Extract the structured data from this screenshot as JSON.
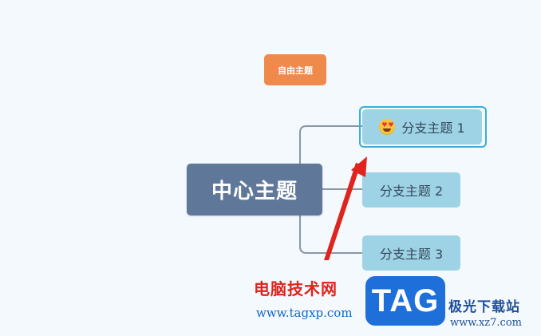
{
  "mindmap": {
    "floating_topic": "自由主题",
    "central_topic": "中心主题",
    "branches": [
      "分支主题 1",
      "分支主题 2",
      "分支主题 3"
    ],
    "branch_1_icon": "heart-eyes-emoji-icon",
    "selected_branch": "分支主题 1"
  },
  "annotation": {
    "arrow_color": "#e0231c"
  },
  "watermark": {
    "site_name": "电脑技术网",
    "site_url": "www.tagxp.com",
    "logo_text": "TAG",
    "site_name_2": "极光下载站",
    "site_url_2": "www.xz7.com"
  },
  "colors": {
    "background": "#f3f9fd",
    "central": "#5f7799",
    "branch": "#9dd3e4",
    "floating": "#ef8a4c",
    "selection": "#3aaed8",
    "connector": "#8a97a6"
  }
}
